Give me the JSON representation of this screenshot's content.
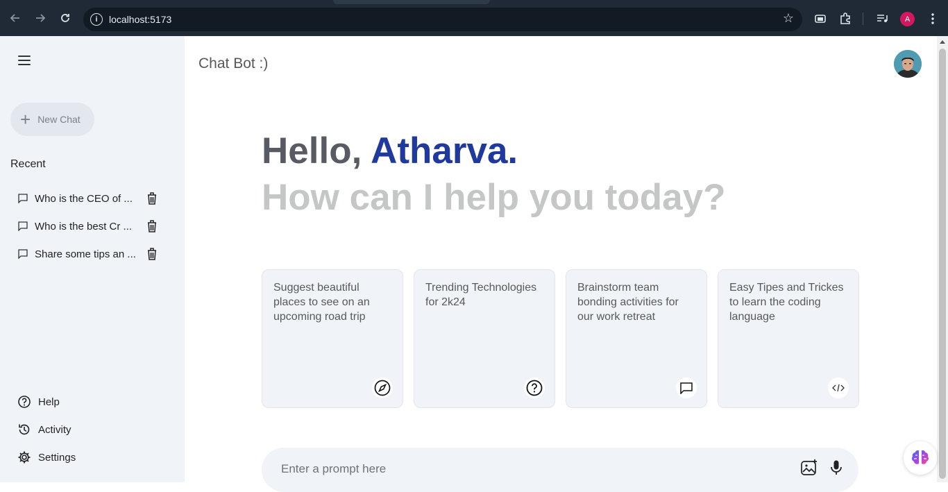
{
  "browser": {
    "url": "localhost:5173",
    "profile_initial": "A",
    "profile_color": "#d5175f"
  },
  "sidebar": {
    "new_chat_label": "New Chat",
    "recent_label": "Recent",
    "recent_items": [
      {
        "label": "Who is the CEO of ..."
      },
      {
        "label": "Who is the best Cr ..."
      },
      {
        "label": "Share some tips an ..."
      }
    ],
    "bottom_items": [
      {
        "label": "Help",
        "icon": "help-icon"
      },
      {
        "label": "Activity",
        "icon": "history-icon"
      },
      {
        "label": "Settings",
        "icon": "gear-icon"
      }
    ]
  },
  "main": {
    "app_title": "Chat Bot :)",
    "greeting_hello": "Hello, ",
    "greeting_name": "Atharva.",
    "greeting_sub": "How can I help you today?",
    "cards": [
      {
        "text": "Suggest beautiful places to see on an upcoming road trip",
        "icon": "compass-icon"
      },
      {
        "text": "Trending Technologies for 2k24",
        "icon": "question-icon"
      },
      {
        "text": "Brainstorm team bonding activities for our work retreat",
        "icon": "message-icon"
      },
      {
        "text": "Easy Tipes and Trickes to learn the coding language",
        "icon": "code-icon"
      }
    ],
    "prompt_placeholder": "Enter a prompt here"
  },
  "colors": {
    "sidebar_bg": "#f0f4f9",
    "accent_name": "#1f3a9c",
    "greeting_gray": "#585b63",
    "sub_gray": "#c4c7c5"
  }
}
